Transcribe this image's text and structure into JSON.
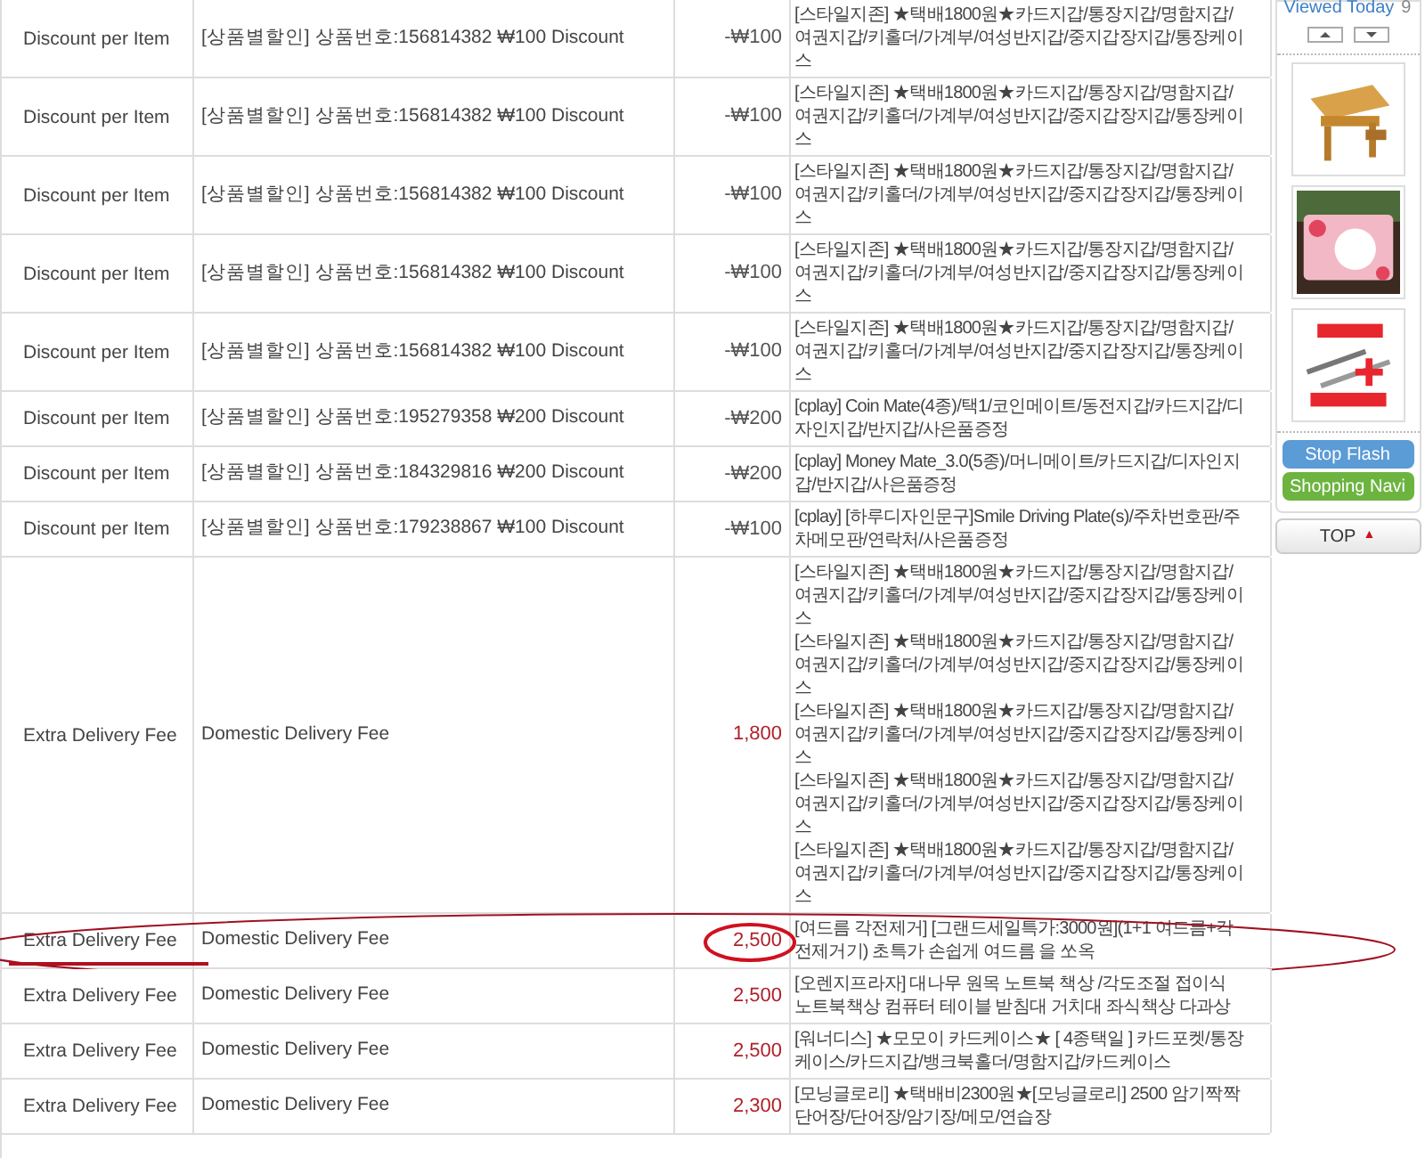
{
  "rows": [
    {
      "kind": "discount",
      "type": "Discount per Item",
      "description": "[상품별할인] 상품번호:156814382 ₩100 Discount",
      "amount": "-₩100",
      "products": [
        "[스타일지존] ★택배1800원★카드지갑/통장지갑/명함지갑/여권지갑/키홀더/가계부/여성반지갑/중지갑장지갑/통장케이스"
      ],
      "highlighted": false
    },
    {
      "kind": "discount",
      "type": "Discount per Item",
      "description": "[상품별할인] 상품번호:156814382 ₩100 Discount",
      "amount": "-₩100",
      "products": [
        "[스타일지존] ★택배1800원★카드지갑/통장지갑/명함지갑/여권지갑/키홀더/가계부/여성반지갑/중지갑장지갑/통장케이스"
      ],
      "highlighted": false
    },
    {
      "kind": "discount",
      "type": "Discount per Item",
      "description": "[상품별할인] 상품번호:156814382 ₩100 Discount",
      "amount": "-₩100",
      "products": [
        "[스타일지존] ★택배1800원★카드지갑/통장지갑/명함지갑/여권지갑/키홀더/가계부/여성반지갑/중지갑장지갑/통장케이스"
      ],
      "highlighted": false
    },
    {
      "kind": "discount",
      "type": "Discount per Item",
      "description": "[상품별할인] 상품번호:156814382 ₩100 Discount",
      "amount": "-₩100",
      "products": [
        "[스타일지존] ★택배1800원★카드지갑/통장지갑/명함지갑/여권지갑/키홀더/가계부/여성반지갑/중지갑장지갑/통장케이스"
      ],
      "highlighted": false
    },
    {
      "kind": "discount",
      "type": "Discount per Item",
      "description": "[상품별할인] 상품번호:156814382 ₩100 Discount",
      "amount": "-₩100",
      "products": [
        "[스타일지존] ★택배1800원★카드지갑/통장지갑/명함지갑/여권지갑/키홀더/가계부/여성반지갑/중지갑장지갑/통장케이스"
      ],
      "highlighted": false
    },
    {
      "kind": "discount",
      "type": "Discount per Item",
      "description": "[상품별할인] 상품번호:195279358 ₩200 Discount",
      "amount": "-₩200",
      "products": [
        "[cplay] Coin Mate(4종)/택1/코인메이트/동전지갑/카드지갑/디자인지갑/반지갑/사은품증정"
      ],
      "highlighted": false
    },
    {
      "kind": "discount",
      "type": "Discount per Item",
      "description": "[상품별할인] 상품번호:184329816 ₩200 Discount",
      "amount": "-₩200",
      "products": [
        "[cplay] Money Mate_3.0(5종)/머니메이트/카드지갑/디자인지갑/반지갑/사은품증정"
      ],
      "highlighted": false
    },
    {
      "kind": "discount",
      "type": "Discount per Item",
      "description": "[상품별할인] 상품번호:179238867 ₩100 Discount",
      "amount": "-₩100",
      "products": [
        "[cplay] [하루디자인문구]Smile Driving Plate(s)/주차번호판/주차메모판/연락처/사은품증정"
      ],
      "highlighted": false
    },
    {
      "kind": "fee",
      "type": "Extra Delivery Fee",
      "description": "Domestic Delivery Fee",
      "amount": "1,800",
      "products": [
        "[스타일지존] ★택배1800원★카드지갑/통장지갑/명함지갑/여권지갑/키홀더/가계부/여성반지갑/중지갑장지갑/통장케이스",
        "[스타일지존] ★택배1800원★카드지갑/통장지갑/명함지갑/여권지갑/키홀더/가계부/여성반지갑/중지갑장지갑/통장케이스",
        "[스타일지존] ★택배1800원★카드지갑/통장지갑/명함지갑/여권지갑/키홀더/가계부/여성반지갑/중지갑장지갑/통장케이스",
        "[스타일지존] ★택배1800원★카드지갑/통장지갑/명함지갑/여권지갑/키홀더/가계부/여성반지갑/중지갑장지갑/통장케이스",
        "[스타일지존] ★택배1800원★카드지갑/통장지갑/명함지갑/여권지갑/키홀더/가계부/여성반지갑/중지갑장지갑/통장케이스"
      ],
      "highlighted": false
    },
    {
      "kind": "fee",
      "type": "Extra Delivery Fee",
      "description": "Domestic Delivery Fee",
      "amount": "2,500",
      "products": [
        "[여드름 각전제거] [그랜드세일특가:3000원](1+1 여드름+각전제거기) 초특가 손쉽게 여드름 을 쏘옥"
      ],
      "highlighted": true
    },
    {
      "kind": "fee",
      "type": "Extra Delivery Fee",
      "description": "Domestic Delivery Fee",
      "amount": "2,500",
      "products": [
        "[오렌지프라자] 대나무 원목 노트북 책상 /각도조절 접이식 노트북책상 컴퓨터 테이블 받침대 거치대 좌식책상 다과상"
      ],
      "highlighted": false
    },
    {
      "kind": "fee",
      "type": "Extra Delivery Fee",
      "description": "Domestic Delivery Fee",
      "amount": "2,500",
      "products": [
        "[워너디스] ★모모이 카드케이스★ [ 4종택일 ] 카드포켓/통장케이스/카드지갑/뱅크북홀더/명함지갑/카드케이스"
      ],
      "highlighted": false
    },
    {
      "kind": "fee",
      "type": "Extra Delivery Fee",
      "description": "Domestic Delivery Fee",
      "amount": "2,300",
      "products": [
        "[모닝글로리] ★택배비2300원★[모닝글로리] 2500 암기짝짝단어장/단어장/암기장/메모/연습장"
      ],
      "highlighted": false
    }
  ],
  "sidebar": {
    "viewed_label": "Viewed Today",
    "viewed_count": "9",
    "thumbnails": [
      {
        "kind": "picture"
      },
      {
        "kind": "picture"
      },
      {
        "kind": "picture"
      }
    ],
    "buttons": [
      "Stop Flash",
      "Shopping Navi"
    ],
    "top_label": "TOP",
    "top_icon": "▲"
  }
}
